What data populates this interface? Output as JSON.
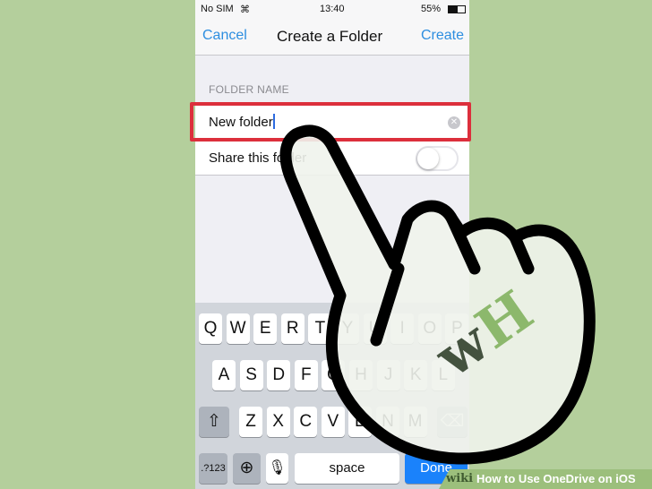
{
  "status": {
    "carrier": "No SIM",
    "time": "13:40",
    "battery": "55%"
  },
  "nav": {
    "cancel": "Cancel",
    "title": "Create a Folder",
    "create": "Create"
  },
  "form": {
    "section_label": "FOLDER NAME",
    "folder_name": "New folder",
    "share_label": "Share this folder",
    "share_on": false
  },
  "keyboard": {
    "row1": [
      "Q",
      "W",
      "E",
      "R",
      "T",
      "Y",
      "U",
      "I",
      "O",
      "P"
    ],
    "row2": [
      "A",
      "S",
      "D",
      "F",
      "G",
      "H",
      "J",
      "K",
      "L"
    ],
    "row3": [
      "Z",
      "X",
      "C",
      "V",
      "B",
      "N",
      "M"
    ],
    "numbers": ".?123",
    "space": "space",
    "done": "Done"
  },
  "watermark": {
    "logo": "wH",
    "caption_brand": "wiki",
    "caption": "How to Use OneDrive on iOS"
  },
  "colors": {
    "accent": "#2d8ee0",
    "highlight": "#dc2f3c",
    "background": "#b4cf9c"
  }
}
